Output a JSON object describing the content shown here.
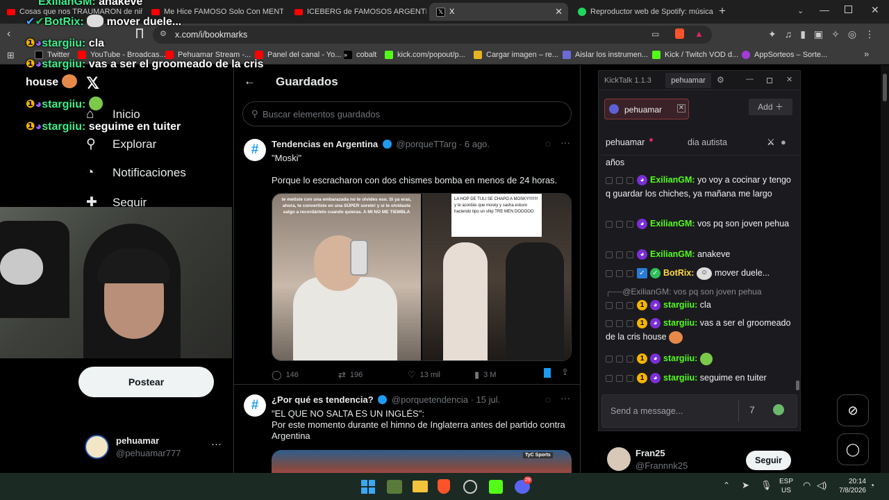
{
  "browser": {
    "tabs": [
      {
        "label": "Cosas que nos TRAUMARON de niño"
      },
      {
        "label": "Me Hice FAMOSO Solo Con MENTIR"
      },
      {
        "label": "ICEBERG de FAMOSOS ARGENTINOS"
      },
      {
        "label": "X"
      },
      {
        "label": "Reproductor web de Spotify: música"
      }
    ],
    "url": "x.com/i/bookmarks",
    "bookmarks": [
      {
        "label": "Twitter"
      },
      {
        "label": "YouTube - Broadcas..."
      },
      {
        "label": "Pehuamar Stream -..."
      },
      {
        "label": "Panel del canal - Yo..."
      },
      {
        "label": "cobalt"
      },
      {
        "label": "kick.com/popout/p..."
      },
      {
        "label": "Cargar imagen – re..."
      },
      {
        "label": "Aislar los instrumen..."
      },
      {
        "label": "Kick / Twitch VOD d..."
      },
      {
        "label": "AppSorteos – Sorte..."
      }
    ]
  },
  "sidebar": {
    "nav": [
      {
        "label": "Inicio"
      },
      {
        "label": "Explorar"
      },
      {
        "label": "Notificaciones"
      },
      {
        "label": "Seguir"
      }
    ],
    "post_button": "Postear",
    "account": {
      "name": "pehuamar",
      "handle": "@pehuamar777"
    }
  },
  "feed": {
    "title": "Guardados",
    "search_placeholder": "Buscar elementos guardados",
    "tweets": [
      {
        "name": "Tendencias en Argentina",
        "handle": "@porqueTTarg",
        "date": "· 6 ago.",
        "line1": "\"Moski\"",
        "line2": "Porque lo escracharon con dos chismes bomba en menos de 24 horas.",
        "img_left_text": "te metiste con una embarazada no te olvides eso. Si ya eras, ahora, te convertiste en una SÚPER sorete! y si te olvidaste salgo a recordártelo cuando quieras. A MI NO ME TIEMBLA",
        "img_right_text": "LA HOP DE TULI SE CHAPO A MOSKY!!!!!!!!  y te acordás que mosky y sasha estuvo haciendo tipo un ship  TRE MEN DOOOOO",
        "replies": "146",
        "retweets": "196",
        "likes": "13 mil",
        "views": "3 M"
      },
      {
        "name": "¿Por qué es tendencia?",
        "handle": "@porquetendencia",
        "date": "· 15 jul.",
        "line1": "\"EL QUE NO SALTA ES UN INGLÉS\":",
        "line2": "Por este momento durante el himno de Inglaterra antes del partido contra Argentina",
        "img_tag": "TyC Sports"
      }
    ]
  },
  "right_col": {
    "suggestion": {
      "name": "Fran25",
      "handle": "@Frannnk25",
      "button": "Seguir"
    }
  },
  "kicktalk": {
    "app_title": "KickTalk 1.1.3",
    "window_tab": "pehuamar",
    "channel_chip": "pehuamar",
    "add_button": "Add",
    "tabs": [
      "pehuamar",
      "dia autista"
    ],
    "messages": [
      {
        "user": "",
        "text": "años"
      },
      {
        "user": "ExilianGM:",
        "text": "yo voy a cocinar y tengo q guardar los chiches, ya mañana me largo"
      },
      {
        "user": "ExilianGM:",
        "text": "vos pq son joven pehua"
      },
      {
        "user": "ExilianGM:",
        "text": "anakeve"
      },
      {
        "user": "BotRix:",
        "text": "mover duele..."
      },
      {
        "user": "",
        "text": "@ExilianGM: vos pq son joven pehua"
      },
      {
        "user": "stargiiu:",
        "text": "cla"
      },
      {
        "user": "stargiiu:",
        "text": "vas a ser el groomeado de la cris house"
      },
      {
        "user": "stargiiu:",
        "text": ""
      },
      {
        "user": "stargiiu:",
        "text": "seguime en tuiter"
      }
    ],
    "input_placeholder": "Send a message..."
  },
  "overlay_chat": [
    {
      "user": "ExilianGM:",
      "text": "anakeve"
    },
    {
      "user": "BotRix:",
      "text": "mover duele..."
    },
    {
      "user": "stargiiu:",
      "text": "cla"
    },
    {
      "user": "stargiiu:",
      "text": "vas a ser el groomeado de la cris"
    },
    {
      "user": "",
      "text": "house"
    },
    {
      "user": "stargiiu:",
      "text": ""
    },
    {
      "user": "stargiiu:",
      "text": "seguime en tuiter"
    }
  ],
  "taskbar": {
    "lang": "ESP",
    "region": "US",
    "time": "20:14",
    "date": "7/8/2026",
    "discord_badge": "29"
  },
  "colors": {
    "kick_green": "#3df08b",
    "x_blue": "#1d9bf0",
    "kick_user_green": "#53fc18"
  }
}
